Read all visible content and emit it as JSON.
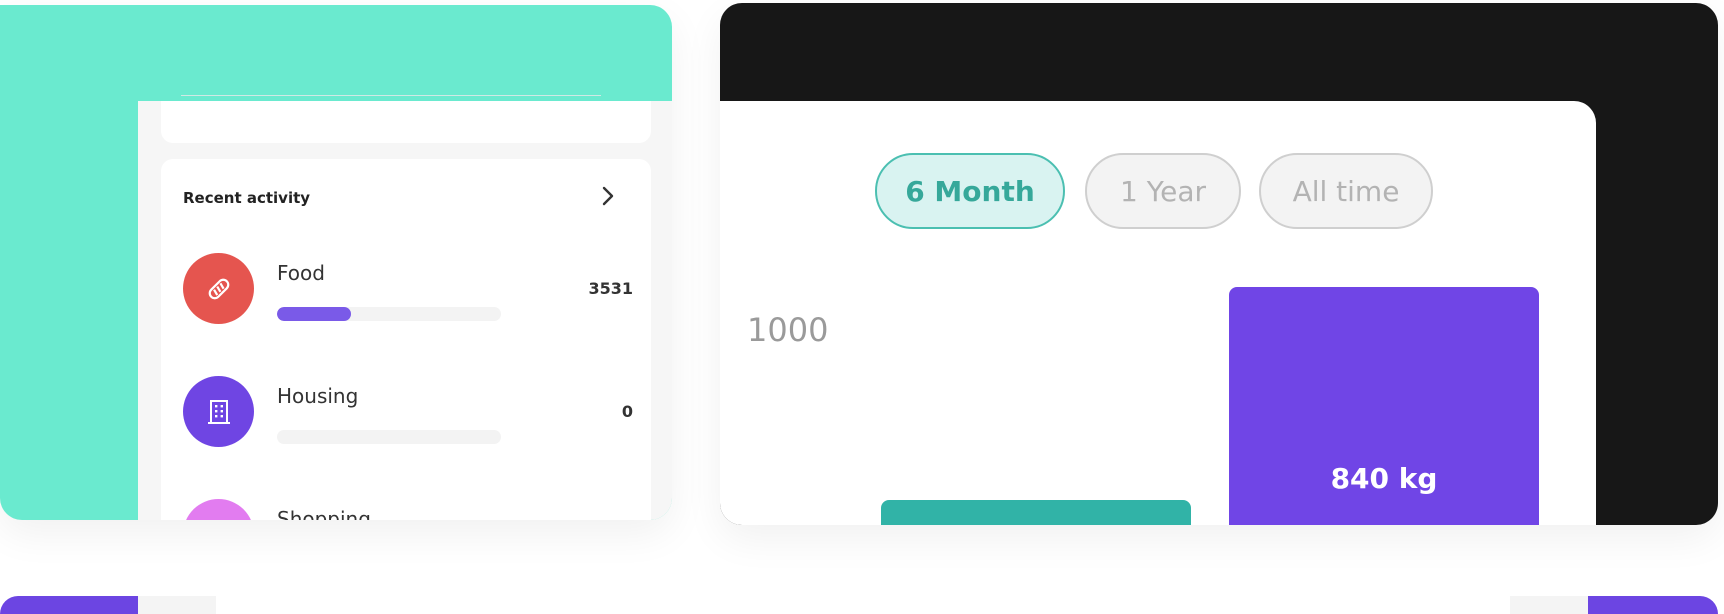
{
  "activity": {
    "title": "Recent activity",
    "items": [
      {
        "label": "Food",
        "value": "3531",
        "progress": 0.33,
        "icon": "bread-icon",
        "color": "#e5554f"
      },
      {
        "label": "Housing",
        "value": "0",
        "progress": 0,
        "icon": "building-icon",
        "color": "#6f45e3"
      },
      {
        "label": "Shopping",
        "value": "",
        "progress": 0,
        "icon": "shopping-icon",
        "color": "#e27cf0"
      }
    ]
  },
  "filters": {
    "tabs": [
      {
        "label": "6 Month",
        "active": true
      },
      {
        "label": "1 Year",
        "active": false
      },
      {
        "label": "All time",
        "active": false
      }
    ]
  },
  "chart_data": {
    "type": "bar",
    "y_tick_labels": [
      "1000"
    ],
    "bar_labels": [
      "",
      "840 kg"
    ],
    "colors": [
      "#31b3a7",
      "#7045e6"
    ]
  },
  "colors": {
    "teal_card": "#6aeacf",
    "dark_card": "#171717",
    "accent_purple": "#7045e6",
    "accent_teal": "#31b3a7"
  }
}
